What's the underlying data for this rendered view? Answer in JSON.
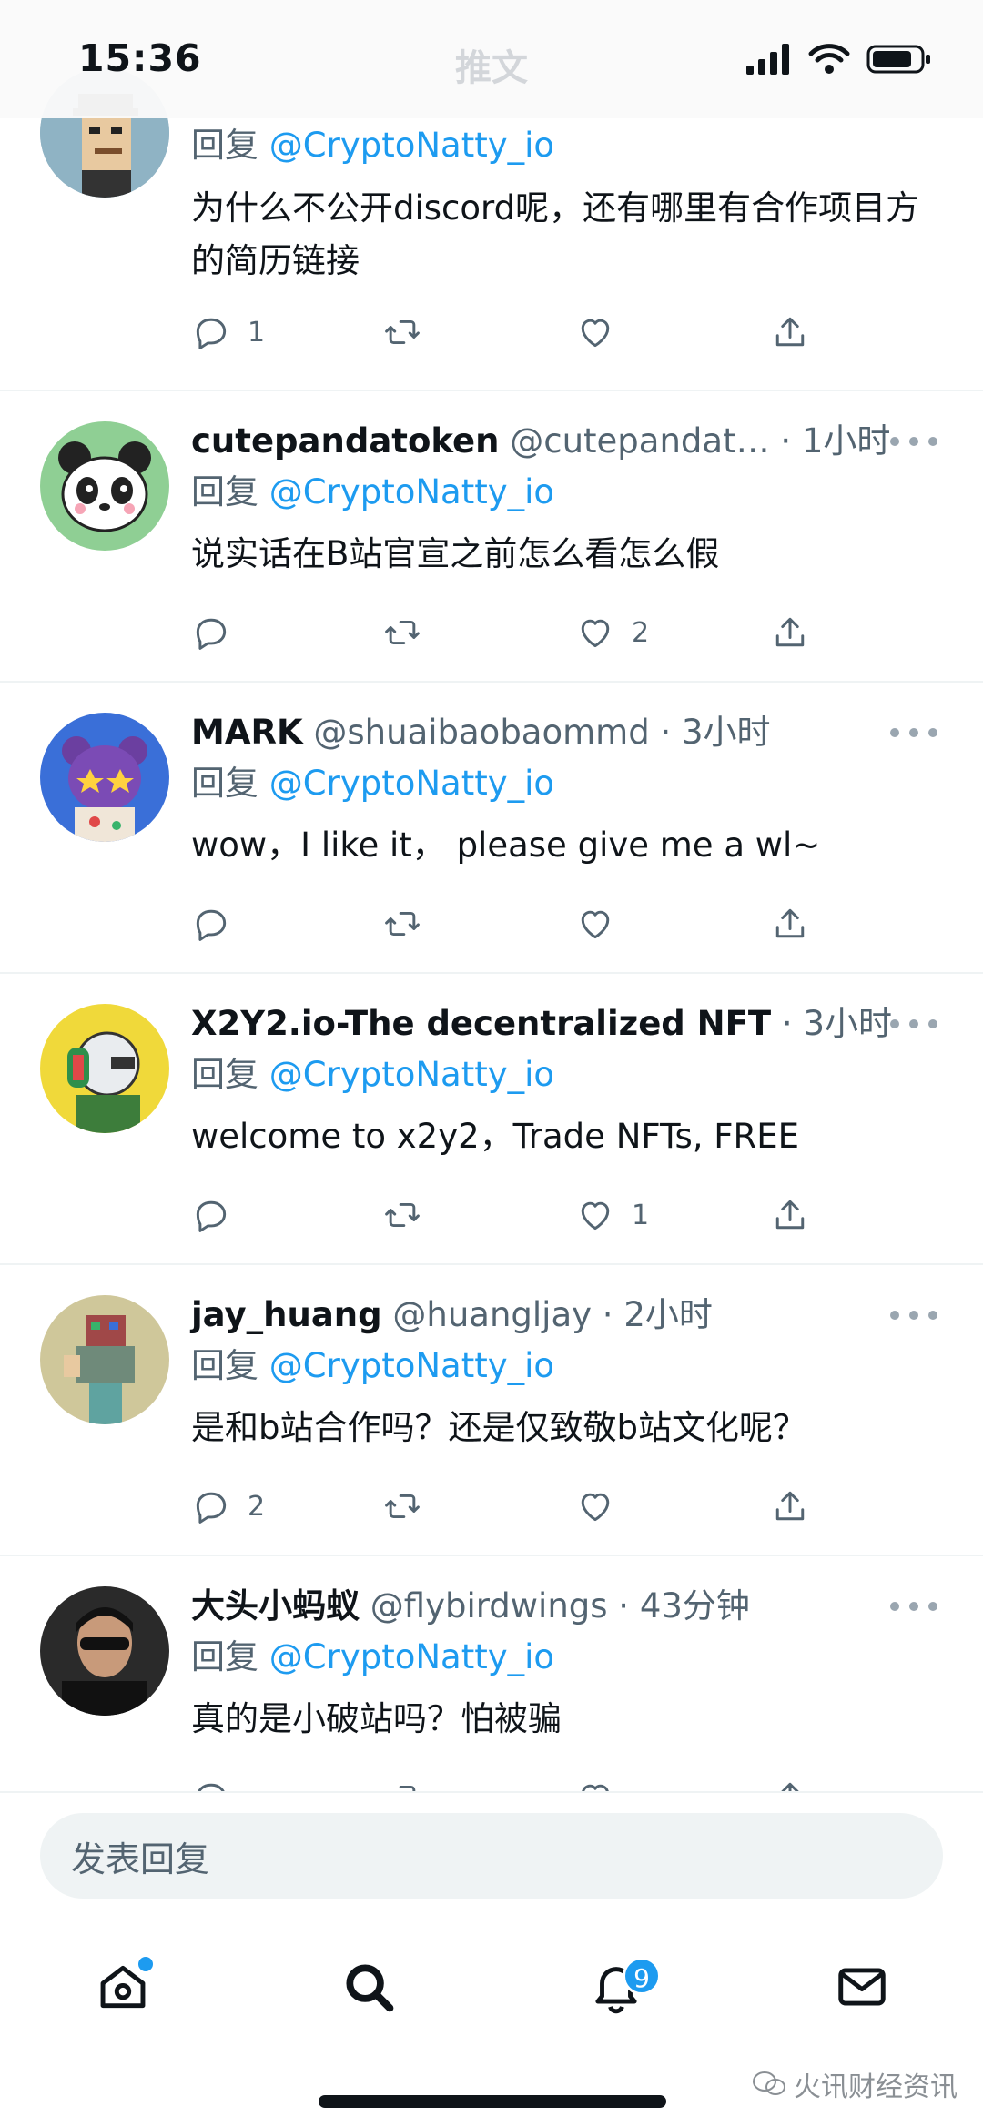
{
  "status_bar": {
    "time": "15:36",
    "title": "推文"
  },
  "tweets": [
    {
      "name": "",
      "handle": "",
      "time": "",
      "reply_prefix": "回复",
      "reply_to": "@CryptoNatty_io",
      "text": "为什么不公开discord呢，还有哪里有合作项目方的简历链接",
      "reply_count": "1",
      "retweet_count": "",
      "like_count": ""
    },
    {
      "name": "cutepandatoken",
      "handle": "@cutepandat…",
      "time": "1小时",
      "reply_prefix": "回复",
      "reply_to": "@CryptoNatty_io",
      "text": "说实话在B站官宣之前怎么看怎么假",
      "reply_count": "",
      "retweet_count": "",
      "like_count": "2"
    },
    {
      "name": "MARK",
      "handle": "@shuaibaobaommd",
      "time": "3小时",
      "reply_prefix": "回复",
      "reply_to": "@CryptoNatty_io",
      "text": "wow，I like it， please give me a wl~",
      "reply_count": "",
      "retweet_count": "",
      "like_count": ""
    },
    {
      "name": "X2Y2.io-The decentralized NFT",
      "handle": "",
      "time": "3小时",
      "reply_prefix": "回复",
      "reply_to": "@CryptoNatty_io",
      "text": "welcome to x2y2，Trade NFTs, FREE",
      "reply_count": "",
      "retweet_count": "",
      "like_count": "1"
    },
    {
      "name": "jay_huang",
      "handle": "@huangljay",
      "time": "2小时",
      "reply_prefix": "回复",
      "reply_to": "@CryptoNatty_io",
      "text": "是和b站合作吗？还是仅致敬b站文化呢？",
      "reply_count": "2",
      "retweet_count": "",
      "like_count": ""
    },
    {
      "name": "大头小蚂蚁",
      "handle": "@flybirdwings",
      "time": "43分钟",
      "reply_prefix": "回复",
      "reply_to": "@CryptoNatty_io",
      "text": "真的是小破站吗？怕被骗",
      "reply_count": "",
      "retweet_count": "",
      "like_count": ""
    }
  ],
  "compose": {
    "placeholder": "发表回复"
  },
  "tab_bar": {
    "notifications_badge": "9"
  },
  "watermark": {
    "text": "火讯财经资讯"
  },
  "colors": {
    "accent": "#1d9bf0",
    "text_primary": "#0f1419",
    "text_secondary": "#536471",
    "divider": "#eff3f4"
  },
  "icons": {
    "reply": "speech-bubble-icon",
    "retweet": "retweet-icon",
    "like": "heart-icon",
    "share": "share-icon",
    "more": "more-dots-icon",
    "home": "home-icon",
    "search": "search-icon",
    "notifications": "bell-icon",
    "messages": "envelope-icon"
  }
}
